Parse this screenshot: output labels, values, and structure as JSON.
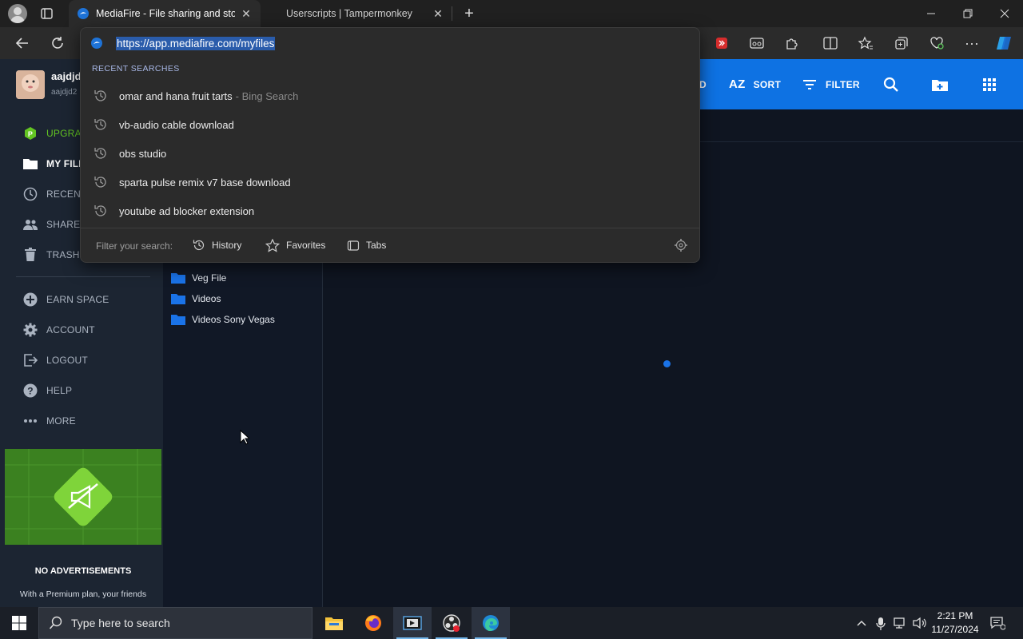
{
  "browser": {
    "tabs": [
      {
        "title": "MediaFire - File sharing and stora",
        "active": true
      },
      {
        "title": "Userscripts | Tampermonkey",
        "active": false
      }
    ],
    "address_bar": {
      "url": "https://app.mediafire.com/myfiles"
    }
  },
  "omnibox": {
    "section_heading": "RECENT SEARCHES",
    "suggestions": [
      {
        "text": "omar and hana fruit tarts",
        "suffix": "- Bing Search"
      },
      {
        "text": "vb-audio cable download",
        "suffix": ""
      },
      {
        "text": "obs studio",
        "suffix": ""
      },
      {
        "text": "sparta pulse remix v7 base download",
        "suffix": ""
      },
      {
        "text": "youtube ad blocker extension",
        "suffix": ""
      }
    ],
    "filter_label": "Filter your search:",
    "filters": [
      "History",
      "Favorites",
      "Tabs"
    ]
  },
  "user": {
    "name": "aajdjd",
    "sub": "aajdjd2"
  },
  "sidebar": {
    "items": [
      {
        "label": "UPGRA",
        "icon": "premium-badge-icon"
      },
      {
        "label": "MY FILE",
        "icon": "folder-icon"
      },
      {
        "label": "RECENT",
        "icon": "clock-icon"
      },
      {
        "label": "SHARED",
        "icon": "people-icon"
      },
      {
        "label": "TRASH",
        "icon": "trash-icon"
      },
      {
        "label": "EARN SPACE",
        "icon": "plus-circle-icon"
      },
      {
        "label": "ACCOUNT",
        "icon": "gear-icon"
      },
      {
        "label": "LOGOUT",
        "icon": "logout-icon"
      },
      {
        "label": "HELP",
        "icon": "help-icon"
      },
      {
        "label": "MORE",
        "icon": "more-dots-icon"
      }
    ],
    "promo": {
      "title": "NO ADVERTISEMENTS",
      "text": "With a Premium plan, your friends"
    }
  },
  "toolbar": {
    "partial_label": "D",
    "sort_label": "SORT",
    "filter_label": "FILTER",
    "sort_icon_text": "AZ"
  },
  "folders": [
    "Veg File",
    "Videos",
    "Videos Sony Vegas"
  ],
  "taskbar": {
    "search_placeholder": "Type here to search",
    "time": "2:21 PM",
    "date": "11/27/2024"
  },
  "colors": {
    "accent_blue": "#0e72e3",
    "premium_green": "#63c522",
    "page_bg": "#0f1521",
    "sidebar_bg": "#1c2532"
  }
}
